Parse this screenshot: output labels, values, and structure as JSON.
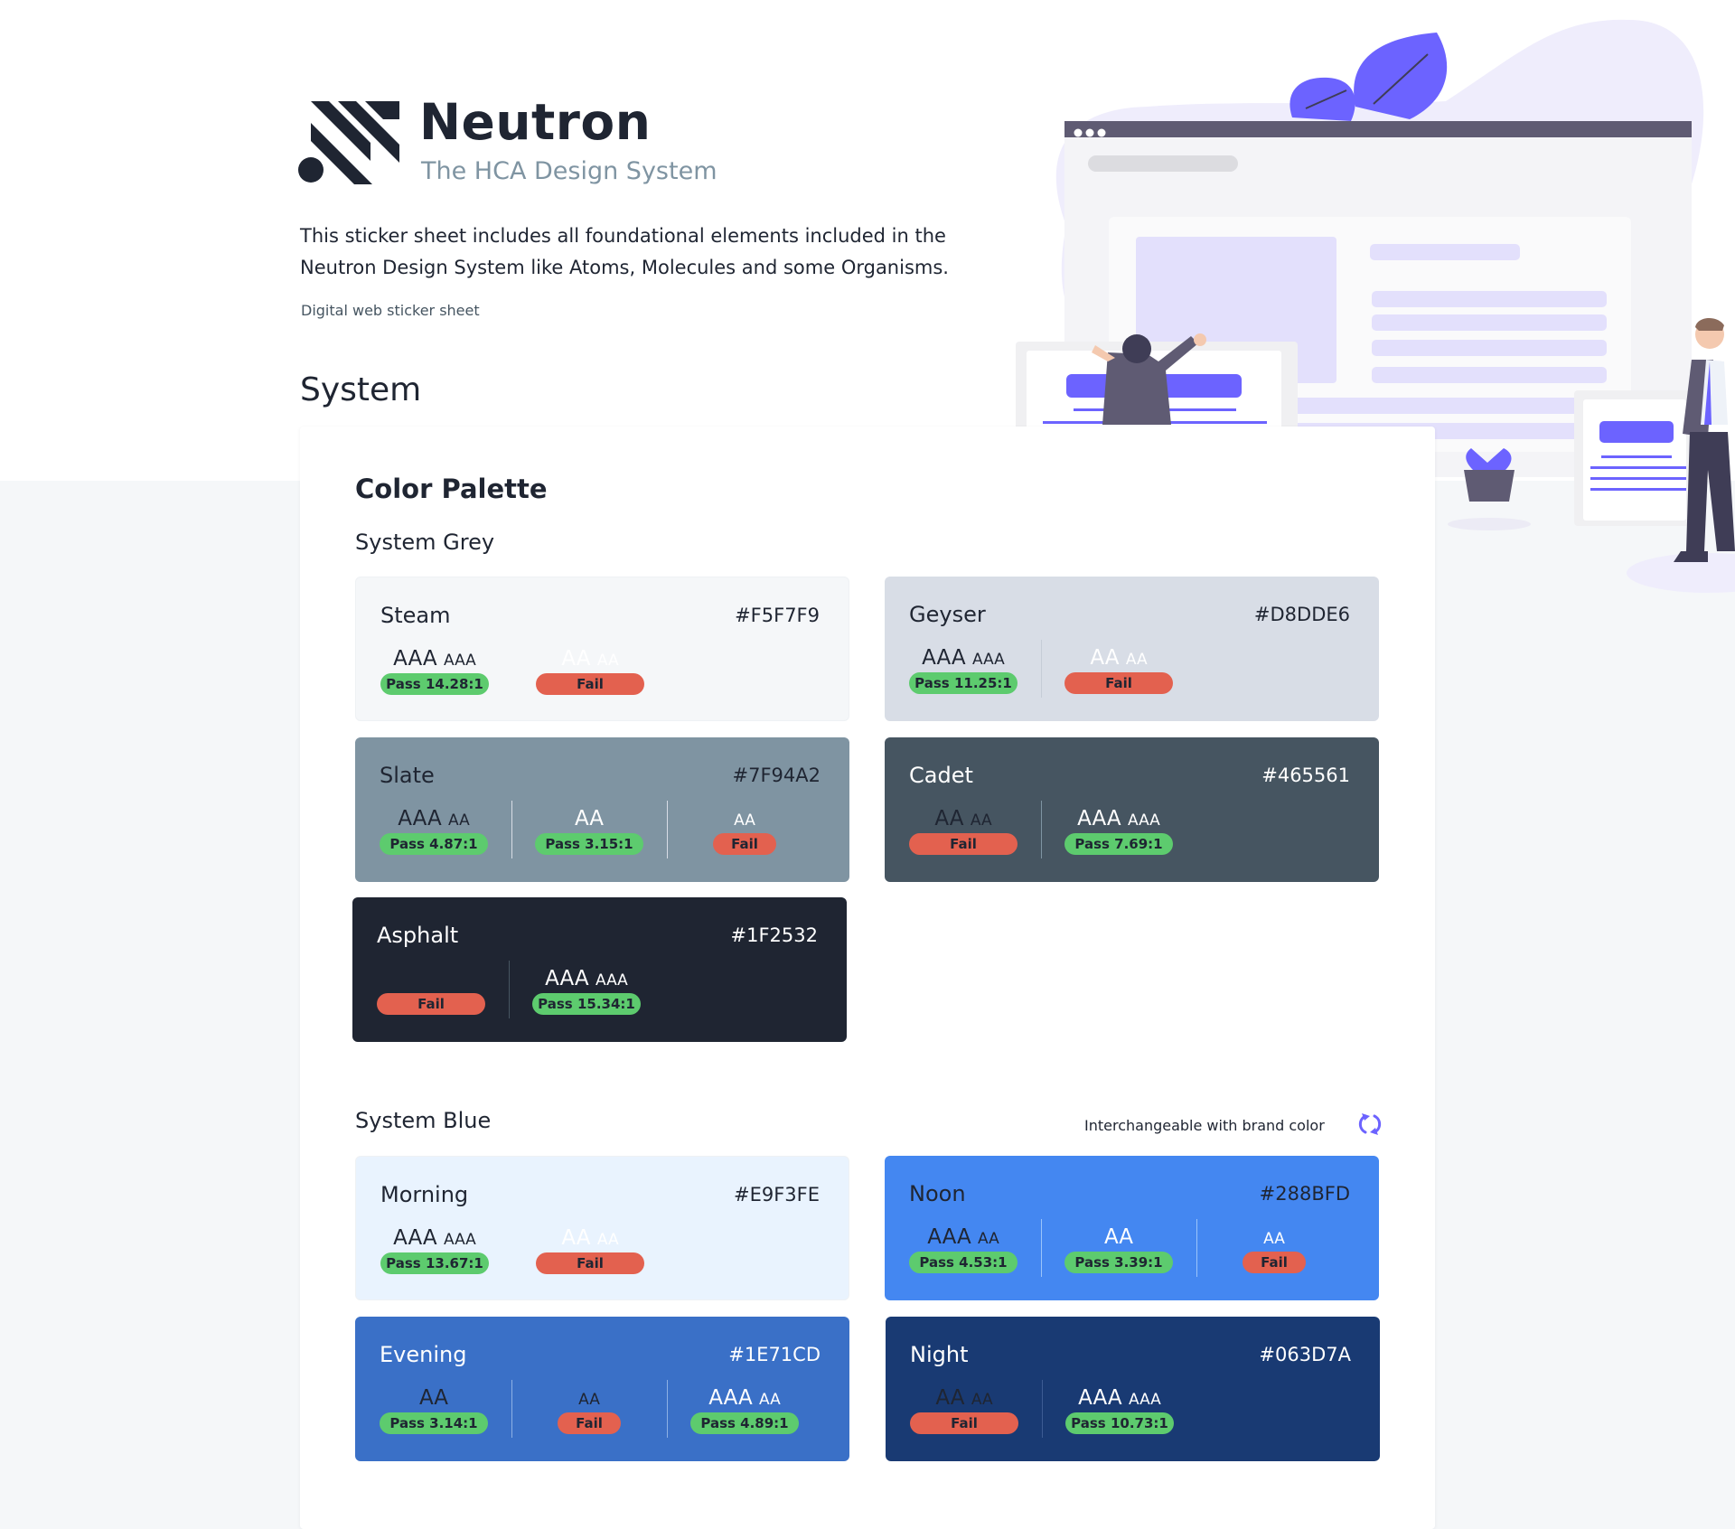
{
  "header": {
    "brand_name": "Neutron",
    "tagline": "The HCA Design System",
    "intro_line1": "This sticker sheet includes all foundational elements included in the",
    "intro_line2": "Neutron Design System like Atoms, Molecules and some Organisms.",
    "sheet_label": "Digital web sticker sheet"
  },
  "system_heading": "System",
  "panel": {
    "title": "Color Palette",
    "groups": [
      {
        "title": "System Grey",
        "cards": [
          {
            "name": "Steam",
            "hex": "#F5F7F9",
            "bg": "#F5F7F9",
            "text": "#1F2532",
            "divider": "none",
            "cols": [
              {
                "label": "AAA",
                "small": "AAA",
                "label_color": "#1F2532",
                "badge": "Pass 14.28:1",
                "status": "pass"
              },
              {
                "label": "AA",
                "small": "AA",
                "label_color": "#FFFFFF",
                "badge": "Fail",
                "status": "fail"
              }
            ]
          },
          {
            "name": "Geyser",
            "hex": "#D8DDE6",
            "bg": "#D8DDE6",
            "text": "#1F2532",
            "divider": "#C5CCD6",
            "cols": [
              {
                "label": "AAA",
                "small": "AAA",
                "label_color": "#1F2532",
                "badge": "Pass 11.25:1",
                "status": "pass"
              },
              {
                "label": "AA",
                "small": "AA",
                "label_color": "#FFFFFF",
                "badge": "Fail",
                "status": "fail"
              }
            ]
          },
          {
            "name": "Slate",
            "hex": "#7F94A2",
            "bg": "#7F94A2",
            "text": "#1F2532",
            "divider": "#D8DDE6",
            "cols": [
              {
                "label": "AAA",
                "small": "AA",
                "label_color": "#1F2532",
                "badge": "Pass 4.87:1",
                "status": "pass"
              },
              {
                "label": "AA",
                "small": "",
                "label_color": "#FFFFFF",
                "badge": "Pass 3.15:1",
                "status": "pass"
              },
              {
                "label": "",
                "small": "AA",
                "label_color": "#FFFFFF",
                "badge": "Fail",
                "status": "fail",
                "short": true
              }
            ]
          },
          {
            "name": "Cadet",
            "hex": "#465561",
            "bg": "#465561",
            "text": "#FFFFFF",
            "divider": "#7F94A2",
            "cols": [
              {
                "label": "AA",
                "small": "AA",
                "label_color": "#1F2532",
                "badge": "Fail",
                "status": "fail"
              },
              {
                "label": "AAA",
                "small": "AAA",
                "label_color": "#FFFFFF",
                "badge": "Pass 7.69:1",
                "status": "pass"
              }
            ]
          },
          {
            "name": "Asphalt",
            "hex": "#1F2532",
            "bg": "#1F2532",
            "text": "#FFFFFF",
            "divider": "#465561",
            "cols": [
              {
                "label": "",
                "small": "",
                "label_color": "#1F2532",
                "badge": "Fail",
                "status": "fail"
              },
              {
                "label": "AAA",
                "small": "AAA",
                "label_color": "#FFFFFF",
                "badge": "Pass 15.34:1",
                "status": "pass"
              }
            ]
          }
        ]
      },
      {
        "title": "System Blue",
        "note": "Interchangeable with brand color",
        "note_icon": "swap-icon",
        "cards": [
          {
            "name": "Morning",
            "hex": "#E9F3FE",
            "bg": "#E9F3FE",
            "text": "#1F2532",
            "divider": "none",
            "cols": [
              {
                "label": "AAA",
                "small": "AAA",
                "label_color": "#1F2532",
                "badge": "Pass 13.67:1",
                "status": "pass"
              },
              {
                "label": "AA",
                "small": "AA",
                "label_color": "#FFFFFF",
                "badge": "Fail",
                "status": "fail"
              }
            ]
          },
          {
            "name": "Noon",
            "hex": "#288BFD",
            "bg": "#4487F1",
            "text": "#1F2532",
            "divider": "#9CC4FA",
            "cols": [
              {
                "label": "AAA",
                "small": "AA",
                "label_color": "#1F2532",
                "badge": "Pass 4.53:1",
                "status": "pass"
              },
              {
                "label": "AA",
                "small": "",
                "label_color": "#FFFFFF",
                "badge": "Pass 3.39:1",
                "status": "pass"
              },
              {
                "label": "",
                "small": "AA",
                "label_color": "#FFFFFF",
                "badge": "Fail",
                "status": "fail",
                "short": true
              }
            ]
          },
          {
            "name": "Evening",
            "hex": "#1E71CD",
            "bg": "#3A70C7",
            "text": "#FFFFFF",
            "divider": "#8DB0E4",
            "cols": [
              {
                "label": "AA",
                "small": "",
                "label_color": "#1F2532",
                "badge": "Pass 3.14:1",
                "status": "pass"
              },
              {
                "label": "",
                "small": "AA",
                "label_color": "#1F2532",
                "badge": "Fail",
                "status": "fail",
                "short": true
              },
              {
                "label": "AAA",
                "small": "AA",
                "label_color": "#FFFFFF",
                "badge": "Pass 4.89:1",
                "status": "pass"
              }
            ]
          },
          {
            "name": "Night",
            "hex": "#063D7A",
            "bg": "#193A73",
            "text": "#FFFFFF",
            "divider": "#3D5C93",
            "cols": [
              {
                "label": "AA",
                "small": "AA",
                "label_color": "#1F2532",
                "badge": "Fail",
                "status": "fail"
              },
              {
                "label": "AAA",
                "small": "AAA",
                "label_color": "#FFFFFF",
                "badge": "Pass 10.73:1",
                "status": "pass"
              }
            ]
          }
        ]
      }
    ]
  },
  "colors": {
    "accent_purple": "#6C63FF",
    "light_purple": "#E7E5FB",
    "pass_green": "#5DCB6E",
    "fail_red": "#E3614F"
  }
}
